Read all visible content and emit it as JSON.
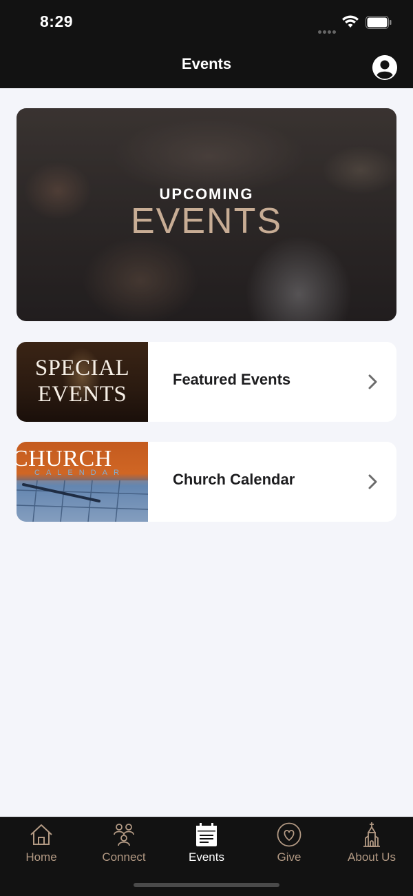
{
  "status_bar": {
    "time": "8:29"
  },
  "header": {
    "title": "Events"
  },
  "hero": {
    "line1": "UPCOMING",
    "line2": "EVENTS"
  },
  "cards": [
    {
      "label": "Featured Events",
      "thumb_line1": "SPECIAL",
      "thumb_line2": "EVENTS"
    },
    {
      "label": "Church Calendar",
      "thumb_line1": "CHURCH",
      "thumb_line2": "CALENDAR"
    }
  ],
  "tabs": [
    {
      "label": "Home",
      "icon": "home-icon"
    },
    {
      "label": "Connect",
      "icon": "people-icon"
    },
    {
      "label": "Events",
      "icon": "calendar-icon",
      "active": true
    },
    {
      "label": "Give",
      "icon": "heart-icon"
    },
    {
      "label": "About Us",
      "icon": "church-icon"
    }
  ],
  "colors": {
    "header_bg": "#121212",
    "accent_gold": "#b39a84",
    "page_bg": "#f4f5fa"
  }
}
